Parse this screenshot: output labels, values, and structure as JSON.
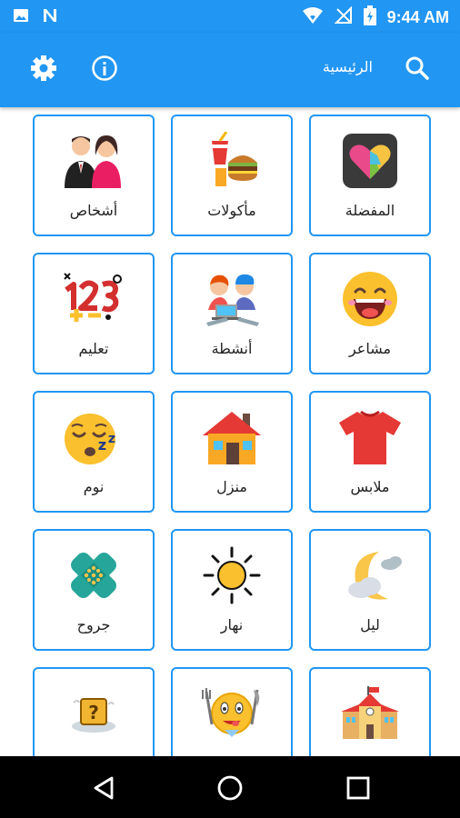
{
  "status_bar": {
    "time": "9:44 AM",
    "icons": [
      "image-icon",
      "n-notification-icon",
      "wifi-icon",
      "no-signal-icon",
      "battery-icon"
    ]
  },
  "app_bar": {
    "title": "الرئيسية",
    "buttons": [
      "settings-icon",
      "info-icon",
      "search-icon"
    ],
    "color": "#2196f3"
  },
  "categories": [
    {
      "label": "المفضلة",
      "icon": "favorites-heart-puzzle-icon"
    },
    {
      "label": "مأكولات",
      "icon": "food-burger-drink-icon"
    },
    {
      "label": "أشخاص",
      "icon": "people-couple-icon"
    },
    {
      "label": "مشاعر",
      "icon": "feelings-laughing-face-icon"
    },
    {
      "label": "أنشطة",
      "icon": "activities-kids-laptop-icon"
    },
    {
      "label": "تعليم",
      "icon": "education-123-icon"
    },
    {
      "label": "ملابس",
      "icon": "clothes-tshirt-icon"
    },
    {
      "label": "منزل",
      "icon": "house-icon"
    },
    {
      "label": "نوم",
      "icon": "sleeping-face-icon"
    },
    {
      "label": "ليل",
      "icon": "night-moon-cloud-icon"
    },
    {
      "label": "نهار",
      "icon": "day-sun-icon"
    },
    {
      "label": "جروح",
      "icon": "bandage-icon"
    },
    {
      "label": "",
      "icon": "school-building-icon"
    },
    {
      "label": "",
      "icon": "hungry-emoji-fork-knife-icon"
    },
    {
      "label": "",
      "icon": "question-box-icon"
    }
  ],
  "nav_bar": {
    "buttons": [
      "back-icon",
      "home-icon",
      "recents-icon"
    ]
  },
  "colors": {
    "accent": "#2196f3",
    "card_border": "#2196f3"
  }
}
